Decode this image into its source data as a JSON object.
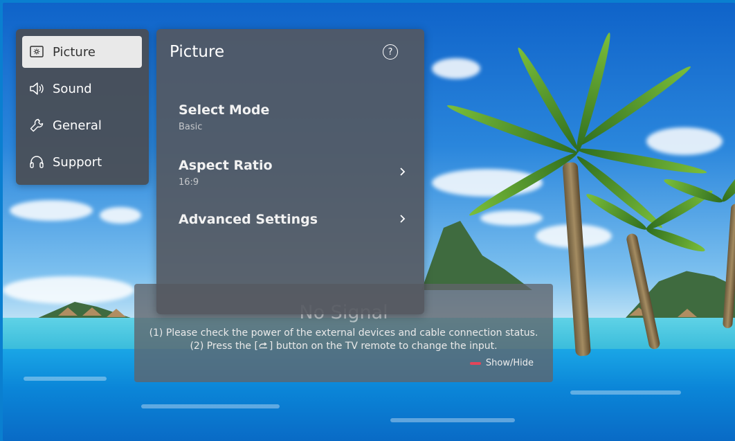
{
  "sidebar": {
    "items": [
      {
        "label": "Picture",
        "icon": "picture-icon",
        "active": true
      },
      {
        "label": "Sound",
        "icon": "speaker-icon",
        "active": false
      },
      {
        "label": "General",
        "icon": "wrench-icon",
        "active": false
      },
      {
        "label": "Support",
        "icon": "headset-icon",
        "active": false
      }
    ]
  },
  "panel": {
    "title": "Picture",
    "help_icon": "help-icon",
    "items": [
      {
        "label": "Select Mode",
        "value": "Basic",
        "has_arrow": false
      },
      {
        "label": "Aspect Ratio",
        "value": "16:9",
        "has_arrow": true
      },
      {
        "label": "Advanced Settings",
        "value": "",
        "has_arrow": true
      }
    ]
  },
  "no_signal": {
    "title": "No Signal",
    "line1": "(1) Please check the power of the external devices and cable connection status.",
    "line2_before": "(2) Press the [",
    "line2_after": "] button on the TV remote to change the input.",
    "input_icon": "input-icon",
    "show_hide_label": "Show/Hide",
    "show_hide_color": "#e5455a"
  }
}
